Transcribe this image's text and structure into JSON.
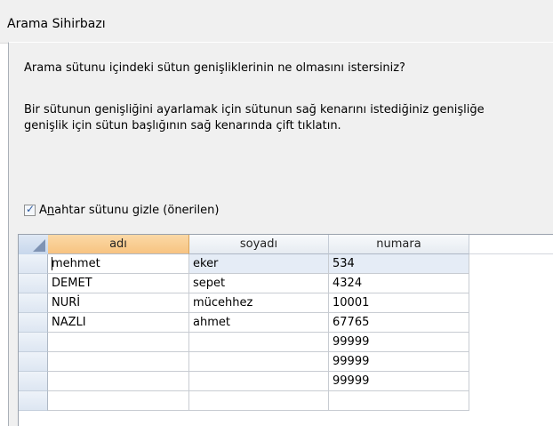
{
  "window": {
    "title": "Arama Sihirbazı"
  },
  "instructions": {
    "question": "Arama sütunu içindeki sütun genişliklerinin ne olmasını istersiniz?",
    "line1": "Bir sütunun genişliğini ayarlamak için sütunun sağ kenarını istediğiniz genişliğe",
    "line2": "genişlik için sütun başlığının sağ kenarında çift tıklatın."
  },
  "hide_key": {
    "checked": true,
    "label_pre": "A",
    "label_underline": "n",
    "label_post": "ahtar sütunu gizle (önerilen)"
  },
  "grid": {
    "columns": [
      "adı",
      "soyadı",
      "numara"
    ],
    "selected_column": "adı",
    "rows": [
      [
        "mehmet",
        "eker",
        "534"
      ],
      [
        "DEMET",
        "sepet",
        "4324"
      ],
      [
        "NURİ",
        "mücehhez",
        "10001"
      ],
      [
        "NAZLI",
        "ahmet",
        "67765"
      ],
      [
        "",
        "",
        "99999"
      ],
      [
        "",
        "",
        "99999"
      ],
      [
        "",
        "",
        "99999"
      ],
      [
        "",
        "",
        ""
      ]
    ]
  }
}
